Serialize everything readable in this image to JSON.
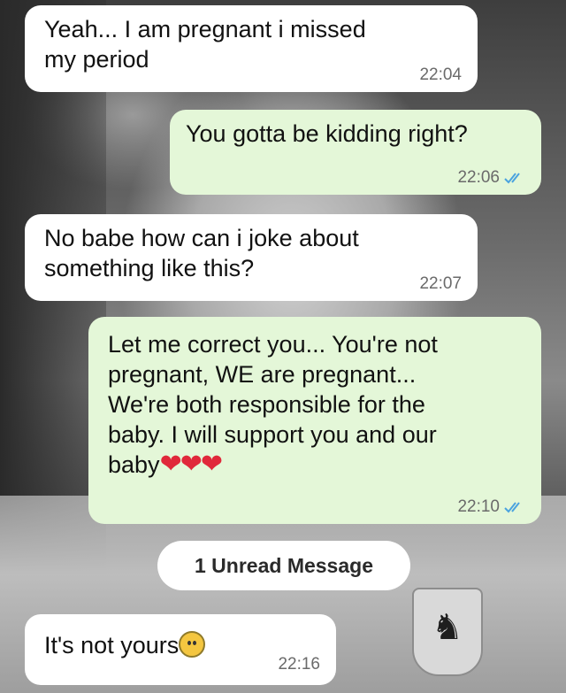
{
  "messages": [
    {
      "text_line1": "Yeah... I am pregnant i missed",
      "text_line2": "my period",
      "time": "22:04",
      "direction": "incoming"
    },
    {
      "text_line1": "You gotta be kidding right?",
      "time": "22:06",
      "direction": "outgoing",
      "status": "read-ticks"
    },
    {
      "text_line1": "No babe how can i joke about",
      "text_line2": "something like this?",
      "time": "22:07",
      "direction": "incoming"
    },
    {
      "text_line1": "Let me correct you... You're not",
      "text_line2": "pregnant, WE are pregnant...",
      "text_line3": "We're both responsible for the",
      "text_line4": "baby. I will support you and our",
      "text_line5": "baby",
      "emoji": "❤❤❤",
      "time": "22:10",
      "direction": "outgoing",
      "status": "read-ticks"
    },
    {
      "text_line1": "It's not yours",
      "emoji_icon": "woman-gesturing-emoji",
      "time": "22:16",
      "direction": "incoming"
    }
  ],
  "unread_label": "1 Unread Message",
  "colors": {
    "incoming_bubble": "#ffffff",
    "outgoing_bubble": "#e4f7d8",
    "tick": "#4aa3df",
    "heart": "#e0283a"
  },
  "icons": {
    "read_receipt": "double-check-icon",
    "background_logo": "prancing-horse-icon"
  }
}
